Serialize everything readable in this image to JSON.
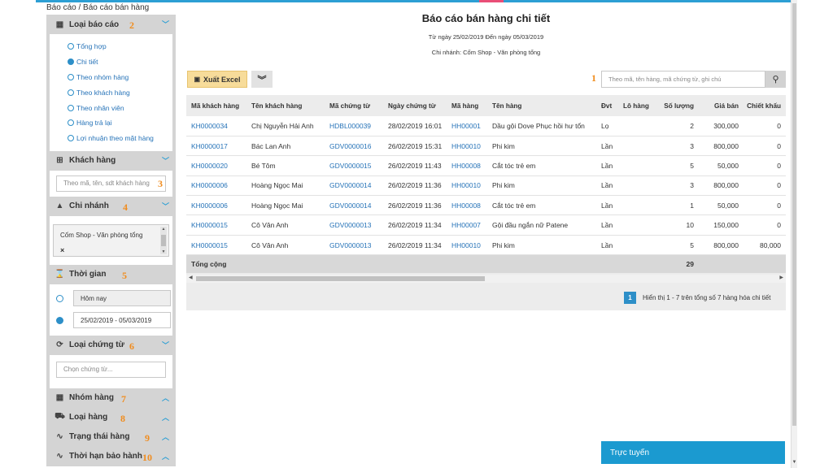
{
  "breadcrumb": "Báo cáo / Báo cáo bán hàng",
  "sidebar": {
    "report_type": {
      "title": "Loại báo cáo",
      "num": "2",
      "options": [
        {
          "label": "Tổng hợp",
          "selected": false
        },
        {
          "label": "Chi tiết",
          "selected": true
        },
        {
          "label": "Theo nhóm hàng",
          "selected": false
        },
        {
          "label": "Theo khách hàng",
          "selected": false
        },
        {
          "label": "Theo nhân viên",
          "selected": false
        },
        {
          "label": "Hàng trả lại",
          "selected": false
        },
        {
          "label": "Lợi nhuận theo mặt hàng",
          "selected": false
        }
      ]
    },
    "customer": {
      "title": "Khách hàng",
      "placeholder": "Theo mã, tên, sdt khách hàng",
      "num": "3"
    },
    "branch": {
      "title": "Chi nhánh",
      "num": "4",
      "selected": "Cốm Shop - Văn phòng tổng",
      "remove": "×"
    },
    "time": {
      "title": "Thời gian",
      "num": "5",
      "option_today": "Hôm nay",
      "option_range": "25/02/2019 - 05/03/2019"
    },
    "doc_type": {
      "title": "Loại chứng từ",
      "num": "6",
      "placeholder": "Chọn chứng từ..."
    },
    "product_group": {
      "title": "Nhóm hàng",
      "num": "7"
    },
    "product_type": {
      "title": "Loại hàng",
      "num": "8"
    },
    "product_status": {
      "title": "Trạng thái hàng",
      "num": "9"
    },
    "warranty": {
      "title": "Thời hạn bảo hành",
      "num": "10"
    }
  },
  "report": {
    "title": "Báo cáo bán hàng chi tiết",
    "date_range": "Từ ngày 25/02/2019 Đến ngày 05/03/2019",
    "branch": "Chi nhánh: Cốm Shop - Văn phòng tổng"
  },
  "toolbar": {
    "export_label": "Xuất Excel",
    "search_placeholder": "Theo mã, tên hàng, mã chứng từ, ghi chú",
    "num": "1"
  },
  "table": {
    "headers": [
      "Mã khách hàng",
      "Tên khách hàng",
      "Mã chứng từ",
      "Ngày chứng từ",
      "Mã hàng",
      "Tên hàng",
      "Đvt",
      "Lô hàng",
      "Số lượng",
      "Giá bán",
      "Chiết khấu"
    ],
    "rows": [
      [
        "KH0000034",
        "Chị Nguyễn Hải Anh",
        "HDBL000039",
        "28/02/2019 16:01",
        "HH00001",
        "Dầu gội Dove Phục hồi hư tổn",
        "Lọ",
        "",
        "2",
        "300,000",
        "0"
      ],
      [
        "KH0000017",
        "Bác Lan Anh",
        "GDV0000016",
        "26/02/2019 15:31",
        "HH00010",
        "Phi kim",
        "Lần",
        "",
        "3",
        "800,000",
        "0"
      ],
      [
        "KH0000020",
        "Bé Tôm",
        "GDV0000015",
        "26/02/2019 11:43",
        "HH00008",
        "Cắt tóc trẻ em",
        "Lần",
        "",
        "5",
        "50,000",
        "0"
      ],
      [
        "KH0000006",
        "Hoàng Ngọc Mai",
        "GDV0000014",
        "26/02/2019 11:36",
        "HH00010",
        "Phi kim",
        "Lần",
        "",
        "3",
        "800,000",
        "0"
      ],
      [
        "KH0000006",
        "Hoàng Ngọc Mai",
        "GDV0000014",
        "26/02/2019 11:36",
        "HH00008",
        "Cắt tóc trẻ em",
        "Lần",
        "",
        "1",
        "50,000",
        "0"
      ],
      [
        "KH0000015",
        "Cô Vân Anh",
        "GDV0000013",
        "26/02/2019 11:34",
        "HH00007",
        "Gội đầu ngắn nữ Patene",
        "Lần",
        "",
        "10",
        "150,000",
        "0"
      ],
      [
        "KH0000015",
        "Cô Vân Anh",
        "GDV0000013",
        "26/02/2019 11:34",
        "HH00010",
        "Phi kim",
        "Lần",
        "",
        "5",
        "800,000",
        "80,000"
      ]
    ],
    "total_label": "Tổng cộng",
    "total_qty": "29"
  },
  "pager": {
    "current": "1",
    "info": "Hiển thị 1 - 7 trên tổng số 7 hàng hóa chi tiết"
  },
  "chat": {
    "label": "Trực tuyến"
  },
  "colors": {
    "accent": "#2d9fd4",
    "number_marker": "#f08c1e",
    "export_button": "#f7dc9a"
  }
}
